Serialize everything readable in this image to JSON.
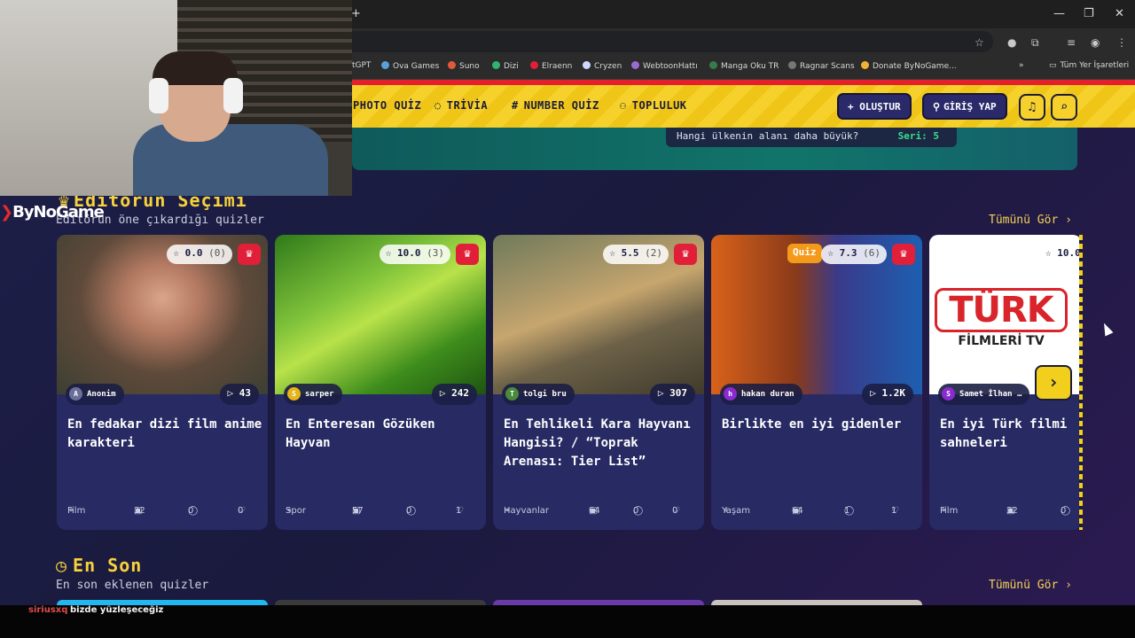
{
  "browser": {
    "close_icon": "✕",
    "minimize_icon": "—",
    "restore_icon": "❐",
    "new_tab_icon": "+",
    "bookmarks": [
      {
        "label": "tGPT",
        "color": "#2b2b2b"
      },
      {
        "label": "Ova Games",
        "color": "#5aa0d8"
      },
      {
        "label": "Suno",
        "color": "#e05a3a"
      },
      {
        "label": "Dizi",
        "color": "#2fb36e"
      },
      {
        "label": "Elraenn",
        "color": "#e21f39"
      },
      {
        "label": "Cryzen",
        "color": "#d0d8ff"
      },
      {
        "label": "WebtoonHattı",
        "color": "#9a6bd0"
      },
      {
        "label": "Manga Oku TR",
        "color": "#3a7a4a"
      },
      {
        "label": "Ragnar Scans",
        "color": "#777777"
      },
      {
        "label": "Donate ByNoGame...",
        "color": "#f2b233"
      }
    ],
    "bookmarks_more": "»",
    "all_bookmarks": "Tüm Yer İşaretleri"
  },
  "nav": {
    "items": [
      "PHOTO QUİZ",
      "TRİVİA",
      "NUMBER QUİZ",
      "TOPLULUK"
    ],
    "create_label": "+ OLUŞTUR",
    "login_label": "GİRİŞ YAP",
    "bell_icon": "🔔",
    "search_icon": "⌕"
  },
  "hero": {
    "question": "Hangi ülkenin alanı daha büyük?",
    "streak": "Seri: 5"
  },
  "editors_pick": {
    "title": "Editörün Seçimi",
    "subtitle": "Editörün öne çıkardığı quizler",
    "see_all": "Tümünü Gör ›",
    "cards": [
      {
        "rating": "0.0",
        "rating_count": "(0)",
        "author": "Anonim",
        "author_initial": "A",
        "author_color": "#6a6f9a",
        "plays": "43",
        "title": "En fedakar dizi film anime karakteri",
        "category": "Film",
        "questions": "32",
        "comments": "0",
        "likes": "0"
      },
      {
        "rating": "10.0",
        "rating_count": "(3)",
        "author": "sarper",
        "author_initial": "S",
        "author_color": "#e6b319",
        "plays": "242",
        "title": "En Enteresan Gözüken Hayvan",
        "category": "Spor",
        "questions": "57",
        "comments": "0",
        "likes": "1"
      },
      {
        "rating": "5.5",
        "rating_count": "(2)",
        "author": "tolgi bru",
        "author_initial": "T",
        "author_color": "#4a8a3a",
        "plays": "307",
        "title": "En Tehlikeli Kara Hayvanı Hangisi? / “Toprak Arenası: Tier List”",
        "category": "Hayvanlar",
        "questions": "64",
        "comments": "0",
        "likes": "0"
      },
      {
        "rating": "7.3",
        "rating_count": "(6)",
        "author": "hakan duran",
        "author_initial": "h",
        "author_color": "#8a2bd0",
        "plays": "1.2K",
        "title": "Birlikte en iyi gidenler",
        "category": "Yaşam",
        "questions": "64",
        "comments": "1",
        "likes": "1"
      },
      {
        "rating": "10.0",
        "rating_count": "",
        "author": "Samet İlhan …",
        "author_initial": "S",
        "author_color": "#8a2bd0",
        "plays": "",
        "title": "En iyi Türk filmi sahneleri",
        "category": "Film",
        "questions": "32",
        "comments": "0",
        "likes": ""
      }
    ],
    "next_icon": "›"
  },
  "latest": {
    "title": "En Son",
    "subtitle": "En son eklenen quizler",
    "see_all": "Tümünü Gör ›"
  },
  "card4_badge": "Quiz",
  "card5_image_text": [
    "TÜRK",
    "FİLMLERİ TV"
  ],
  "stream": {
    "logo": "ByNoGame",
    "chat_user": "siriusxq",
    "chat_message": "bizde yüzleşeceğiz"
  }
}
